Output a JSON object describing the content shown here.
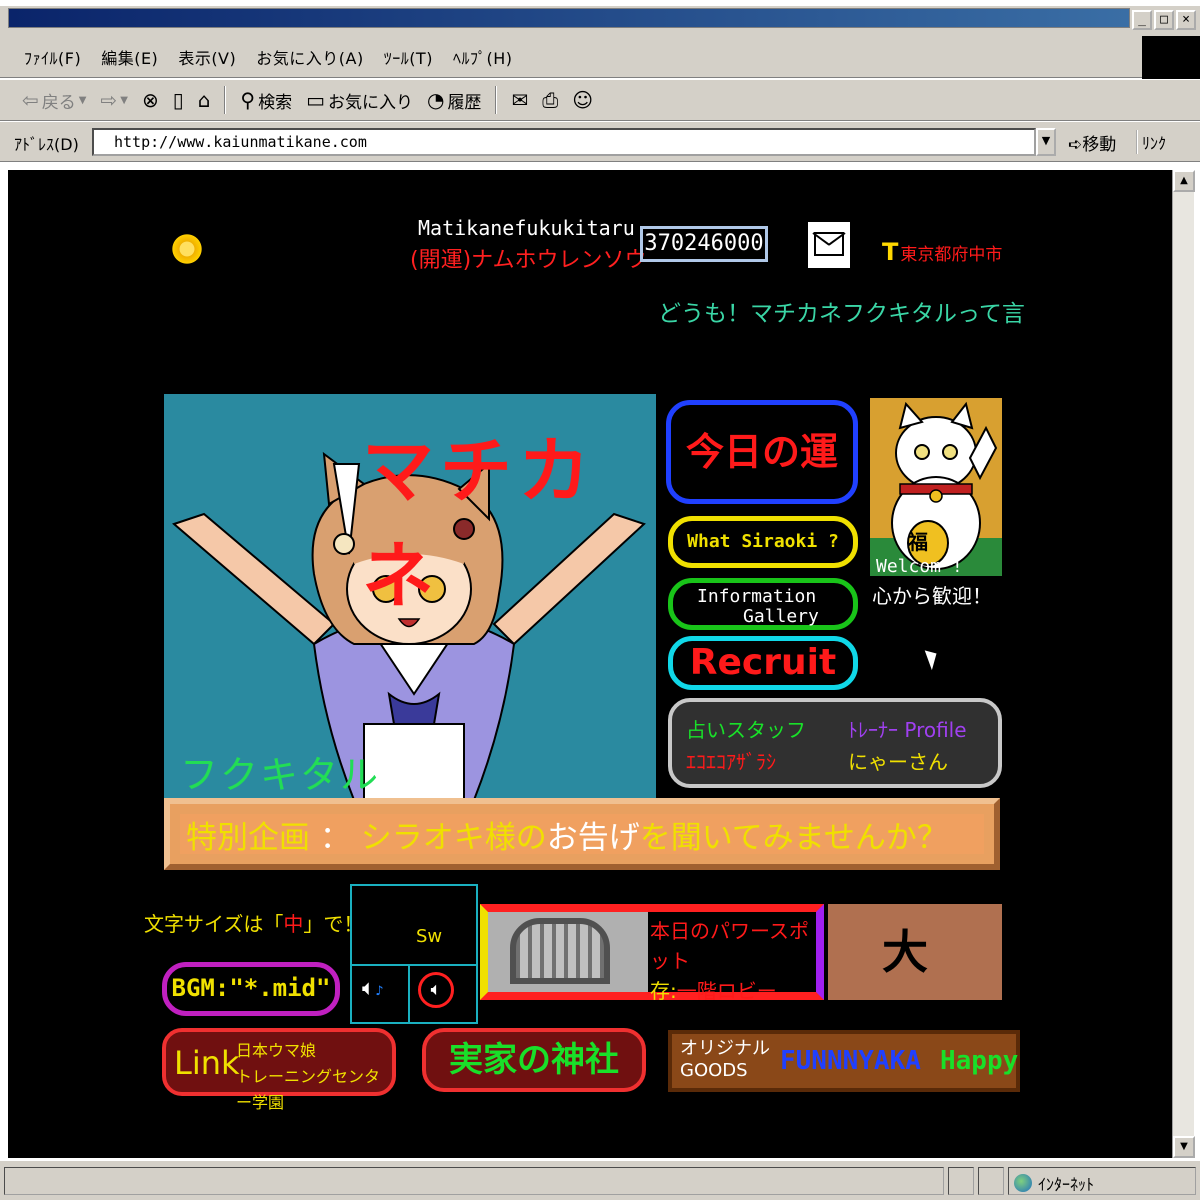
{
  "window": {
    "buttons": [
      "_",
      "□",
      "×"
    ]
  },
  "menubar": {
    "items": [
      "ﾌｧｲﾙ(F)",
      "編集(E)",
      "表示(V)",
      "お気に入り(A)",
      "ﾂｰﾙ(T)",
      "ﾍﾙﾌﾟ(H)"
    ]
  },
  "toolbar": {
    "back": "戻る",
    "search": "検索",
    "favorites": "お気に入り",
    "history": "履歴"
  },
  "address": {
    "label": "ｱﾄﾞﾚｽ(D)",
    "url": "http://www.kaiunmatikane.com",
    "go": "移動",
    "links": "ﾘﾝｸ"
  },
  "status": {
    "zone": "ｲﾝﾀｰﾈｯﾄ"
  },
  "header": {
    "site_name": "Matikanefukukitaru",
    "site_sub": "(開運)ナムホウレンソウ",
    "counter": "370246000",
    "location": "東京都府中市",
    "marquee": "どうも！マチカネフクキタルって言"
  },
  "hero": {
    "title": "マチカネ",
    "name": "フクキタル"
  },
  "nav": {
    "unsei": "今日の運勢",
    "what": "What Siraoki ?",
    "info_l1": "Information",
    "info_l2": "Gallery",
    "recruit": "Recruit"
  },
  "cat": {
    "welcome": "Welcom !",
    "kokoro": "心から歓迎！",
    "fuku": "福"
  },
  "staff": {
    "left_title": "占いスタッフ",
    "left_name": "ｴｺｴｺｱｻﾞﾗｼ",
    "right_title": "ﾄﾚｰﾅｰ Profile",
    "right_name": "にゃーさん"
  },
  "banner": {
    "part1": "特別企画",
    "colon": " ： ",
    "part2": "シラオキ様の",
    "part3": "お告げ",
    "part4": "を聞いてみませんか？"
  },
  "fontsize": {
    "pre": "文字サイズは「",
    "val": "中",
    "post": "」で！"
  },
  "bgm": {
    "label": "BGM:\"*.mid\""
  },
  "sw": {
    "label": "Sw"
  },
  "power": {
    "line1": "本日のパワースポット",
    "line2_a": "存:",
    "line2_b": "一階ロビー"
  },
  "fortune": {
    "value": "大吉"
  },
  "links": {
    "link_big": "Link",
    "link_l1": "日本ウマ娘",
    "link_l2": "トレーニングセンター学園",
    "shrine": "実家の神社",
    "goods_l1": "オリジナル",
    "goods_l2": "GOODS",
    "goods_brand": "FUNNNYAKA",
    "goods_happy": "Happy"
  }
}
